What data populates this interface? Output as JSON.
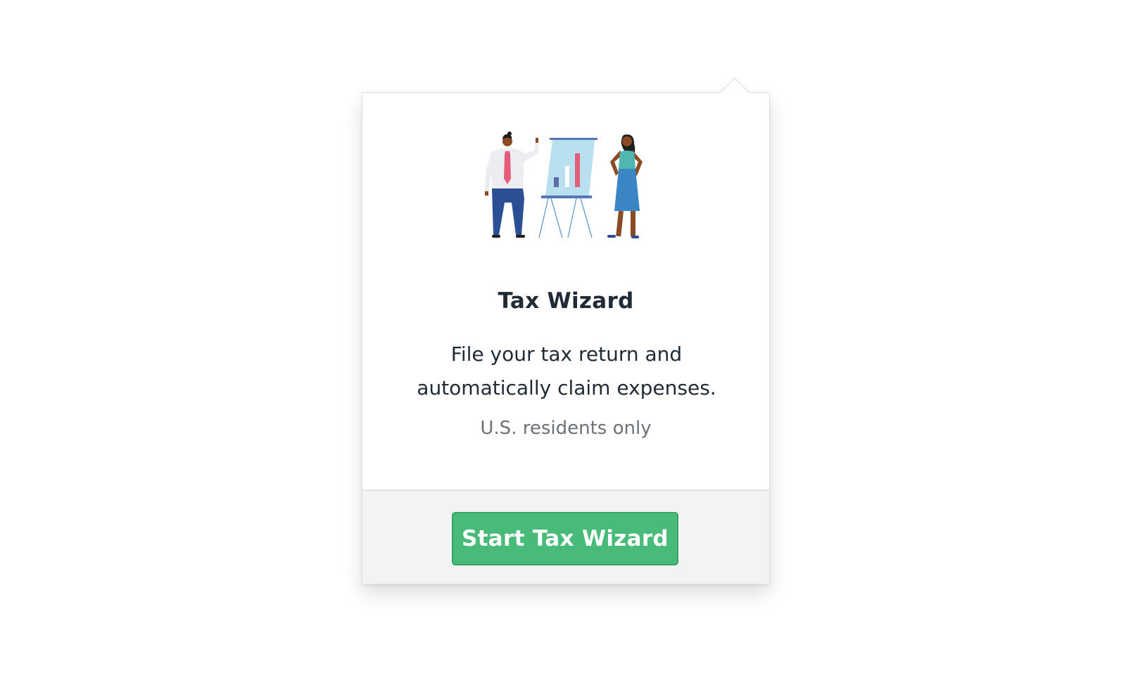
{
  "popover": {
    "title": "Tax Wizard",
    "description": "File your tax return and automatically claim expenses.",
    "note": "U.S. residents only",
    "button_label": "Start Tax Wizard",
    "illustration": "presentation-illustration"
  },
  "colors": {
    "button_bg": "#48bb78",
    "title_text": "#212b36",
    "note_text": "#6b7177",
    "footer_bg": "#f3f3f3"
  }
}
